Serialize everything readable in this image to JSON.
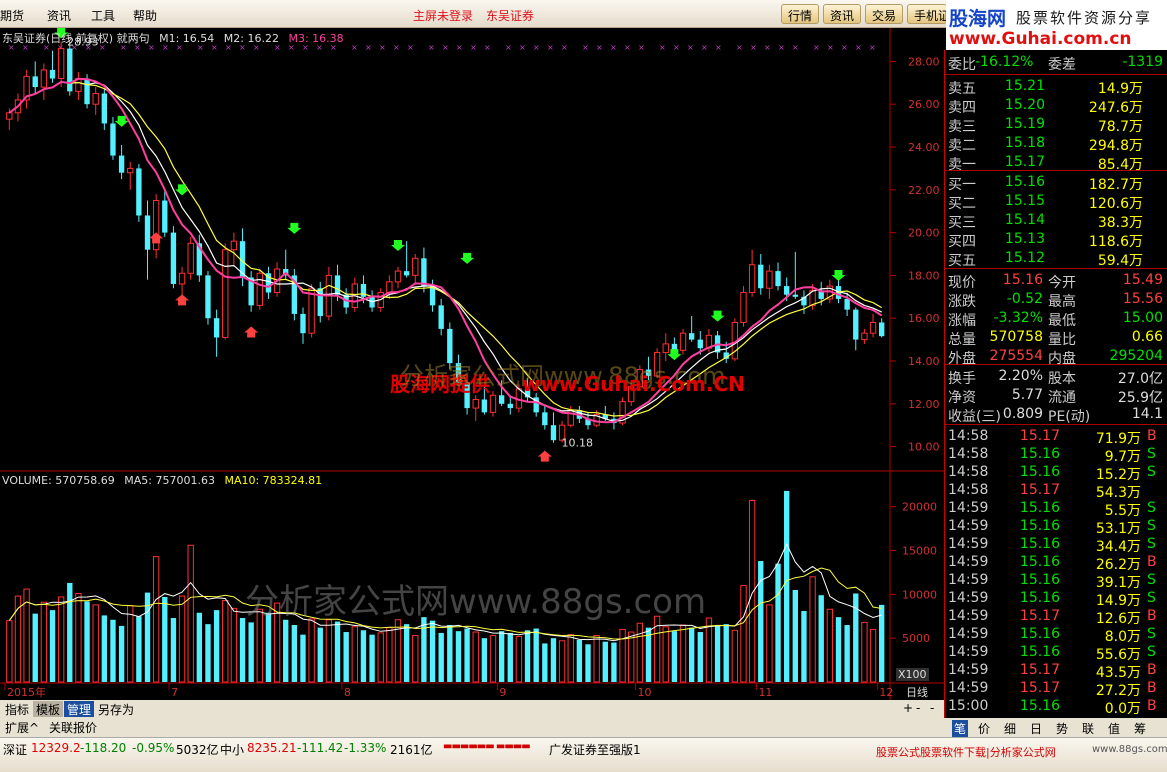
{
  "menu": {
    "items": [
      "期货",
      "资讯",
      "工具",
      "帮助"
    ],
    "notice": [
      "主屏未登录",
      "东吴证券"
    ],
    "buttons": [
      "行情",
      "资讯",
      "交易",
      "手机证"
    ]
  },
  "logo": {
    "name": "股海网",
    "tagline": "股票软件资源分享",
    "url": "www.Guhai.com.cn"
  },
  "chart": {
    "header": {
      "title": "东吴证券(日线 前复权) 就两句",
      "m1": "M1: 16.54",
      "m2": "M2: 16.22",
      "m3": "M3: 16.38"
    },
    "high_label": "28.93",
    "low_label": "10.18",
    "volume_header": {
      "label": "VOLUME: 570758.69",
      "ma5": "MA5: 757001.63",
      "ma10": "MA10: 783324.81"
    },
    "x100": "X100",
    "period": "日线",
    "watermark1": "分析家公式网www.88gs.com",
    "watermark2": "股海网提供",
    "watermark3": "www.Guhai.Com.CN",
    "watermark4": "分析家公式网www.88gs.com"
  },
  "chart_data": {
    "type": "candlestick",
    "ylim": [
      9,
      29
    ],
    "yticks": [
      "28.00",
      "26.00",
      "24.00",
      "22.00",
      "20.00",
      "18.00",
      "16.00",
      "14.00",
      "12.00",
      "10.00"
    ],
    "vticks": [
      "20000",
      "15000",
      "10000",
      "5000"
    ],
    "months": [
      "2015年",
      "7",
      "8",
      "9",
      "10",
      "11",
      "12"
    ],
    "candles": [
      [
        25.3,
        25.8,
        24.8,
        25.6
      ],
      [
        25.6,
        26.5,
        25.2,
        26.2
      ],
      [
        26.2,
        27.6,
        25.8,
        27.3
      ],
      [
        27.3,
        28.0,
        26.5,
        26.8
      ],
      [
        26.8,
        27.9,
        26.2,
        27.6
      ],
      [
        27.6,
        28.5,
        27.0,
        27.2
      ],
      [
        27.2,
        28.93,
        26.8,
        28.6
      ],
      [
        28.6,
        28.8,
        26.4,
        26.6
      ],
      [
        26.6,
        27.5,
        26.2,
        27.2
      ],
      [
        27.2,
        27.4,
        25.8,
        26.0
      ],
      [
        26.0,
        26.8,
        25.5,
        26.5
      ],
      [
        26.5,
        26.7,
        24.8,
        25.1
      ],
      [
        25.1,
        25.4,
        23.4,
        23.6
      ],
      [
        23.6,
        24.1,
        22.5,
        22.8
      ],
      [
        22.8,
        23.3,
        22.0,
        23.0
      ],
      [
        23.0,
        23.2,
        20.5,
        20.8
      ],
      [
        20.8,
        21.5,
        17.8,
        19.2
      ],
      [
        19.2,
        21.8,
        18.8,
        21.5
      ],
      [
        21.5,
        22.0,
        19.8,
        20.0
      ],
      [
        20.0,
        20.3,
        17.4,
        17.6
      ],
      [
        17.6,
        18.4,
        16.8,
        18.1
      ],
      [
        18.1,
        19.8,
        17.8,
        19.5
      ],
      [
        19.5,
        19.9,
        17.7,
        18.0
      ],
      [
        18.0,
        18.2,
        15.7,
        16.0
      ],
      [
        16.0,
        16.4,
        14.2,
        15.1
      ],
      [
        15.1,
        19.5,
        15.0,
        19.2
      ],
      [
        19.2,
        20.0,
        18.5,
        19.6
      ],
      [
        19.6,
        20.2,
        17.5,
        17.9
      ],
      [
        17.9,
        18.2,
        16.3,
        16.6
      ],
      [
        16.6,
        18.3,
        16.4,
        18.1
      ],
      [
        18.1,
        18.4,
        16.9,
        17.2
      ],
      [
        17.2,
        18.6,
        17.0,
        18.3
      ],
      [
        18.3,
        19.2,
        17.8,
        18.0
      ],
      [
        18.0,
        18.3,
        15.9,
        16.2
      ],
      [
        16.2,
        16.5,
        14.8,
        15.3
      ],
      [
        15.3,
        17.6,
        15.1,
        17.4
      ],
      [
        17.4,
        17.7,
        15.8,
        16.1
      ],
      [
        16.1,
        18.4,
        15.9,
        18.0
      ],
      [
        18.0,
        18.5,
        16.8,
        17.1
      ],
      [
        17.1,
        17.4,
        16.2,
        16.5
      ],
      [
        16.5,
        17.9,
        16.3,
        17.6
      ],
      [
        17.6,
        18.0,
        16.7,
        17.0
      ],
      [
        17.0,
        17.3,
        16.3,
        16.5
      ],
      [
        16.5,
        17.4,
        16.3,
        17.2
      ],
      [
        17.2,
        18.0,
        16.9,
        17.7
      ],
      [
        17.7,
        18.4,
        17.4,
        18.2
      ],
      [
        18.2,
        19.6,
        17.9,
        18.0
      ],
      [
        18.0,
        19.0,
        17.6,
        18.8
      ],
      [
        18.8,
        19.3,
        17.2,
        17.5
      ],
      [
        17.5,
        17.8,
        16.3,
        16.6
      ],
      [
        16.6,
        16.9,
        15.2,
        15.5
      ],
      [
        15.5,
        15.8,
        13.6,
        13.9
      ],
      [
        13.9,
        14.3,
        12.7,
        13.0
      ],
      [
        13.0,
        13.2,
        11.5,
        11.8
      ],
      [
        11.8,
        12.4,
        11.2,
        12.2
      ],
      [
        12.2,
        12.9,
        11.5,
        11.6
      ],
      [
        11.6,
        12.6,
        11.4,
        12.4
      ],
      [
        12.4,
        13.1,
        11.9,
        12.0
      ],
      [
        12.0,
        12.4,
        11.5,
        11.8
      ],
      [
        11.8,
        12.9,
        11.6,
        12.7
      ],
      [
        12.7,
        13.2,
        12.1,
        12.3
      ],
      [
        12.3,
        12.5,
        11.4,
        11.6
      ],
      [
        11.6,
        11.9,
        10.8,
        11.0
      ],
      [
        11.0,
        11.6,
        10.18,
        10.3
      ],
      [
        10.3,
        11.2,
        10.2,
        11.0
      ],
      [
        11.0,
        11.9,
        10.9,
        11.7
      ],
      [
        11.7,
        11.9,
        11.1,
        11.3
      ],
      [
        11.3,
        11.6,
        10.8,
        11.0
      ],
      [
        11.0,
        11.7,
        10.9,
        11.5
      ],
      [
        11.5,
        11.9,
        11.2,
        11.3
      ],
      [
        11.3,
        11.6,
        10.8,
        11.1
      ],
      [
        11.1,
        12.3,
        11.0,
        12.1
      ],
      [
        12.1,
        13.0,
        11.9,
        12.8
      ],
      [
        12.8,
        13.8,
        12.6,
        13.6
      ],
      [
        13.6,
        14.2,
        13.1,
        13.3
      ],
      [
        13.3,
        14.6,
        13.2,
        14.4
      ],
      [
        14.4,
        15.3,
        14.0,
        14.8
      ],
      [
        14.8,
        15.1,
        14.2,
        14.5
      ],
      [
        14.5,
        15.5,
        14.3,
        15.3
      ],
      [
        15.3,
        16.1,
        14.9,
        15.0
      ],
      [
        15.0,
        15.4,
        14.3,
        14.6
      ],
      [
        14.6,
        15.5,
        14.4,
        15.2
      ],
      [
        15.2,
        15.4,
        14.1,
        14.4
      ],
      [
        14.4,
        14.9,
        13.9,
        14.1
      ],
      [
        14.1,
        16.0,
        14.0,
        15.8
      ],
      [
        15.8,
        17.5,
        15.6,
        17.2
      ],
      [
        17.2,
        19.2,
        17.0,
        18.5
      ],
      [
        18.5,
        19.0,
        17.1,
        17.4
      ],
      [
        17.4,
        18.5,
        16.9,
        18.2
      ],
      [
        18.2,
        18.6,
        17.3,
        17.5
      ],
      [
        17.5,
        17.9,
        16.8,
        17.1
      ],
      [
        17.1,
        19.1,
        16.9,
        17.0
      ],
      [
        17.0,
        17.3,
        16.2,
        16.6
      ],
      [
        16.6,
        17.6,
        16.4,
        17.3
      ],
      [
        17.3,
        17.7,
        16.6,
        16.9
      ],
      [
        16.9,
        17.8,
        16.7,
        17.5
      ],
      [
        17.5,
        17.8,
        16.7,
        16.9
      ],
      [
        16.9,
        17.2,
        16.1,
        16.4
      ],
      [
        16.4,
        16.5,
        14.5,
        15.0
      ],
      [
        15.0,
        15.5,
        14.8,
        15.3
      ],
      [
        15.3,
        16.2,
        15.1,
        15.8
      ],
      [
        15.8,
        16.0,
        15.1,
        15.16
      ]
    ],
    "volumes": [
      7000,
      9800,
      10600,
      7800,
      9100,
      8200,
      9700,
      11300,
      10100,
      9200,
      8800,
      7600,
      7100,
      6400,
      8700,
      7500,
      10200,
      14300,
      9700,
      7300,
      9800,
      15600,
      7900,
      6600,
      8200,
      9300,
      8400,
      7300,
      6800,
      8300,
      7900,
      9000,
      7100,
      6500,
      5400,
      7200,
      6200,
      7100,
      6900,
      5700,
      6300,
      5900,
      5400,
      5600,
      6200,
      7100,
      6600,
      5300,
      7400,
      7000,
      5600,
      6500,
      5800,
      6100,
      5700,
      5000,
      5300,
      5800,
      5600,
      5200,
      5900,
      6100,
      4400,
      5000,
      4700,
      5400,
      4800,
      4300,
      5300,
      4600,
      4500,
      6000,
      5700,
      6700,
      6200,
      7500,
      6300,
      5800,
      6500,
      6200,
      5700,
      7300,
      6400,
      6600,
      5900,
      11000,
      20700,
      13800,
      8800,
      13500,
      21800,
      10500,
      8100,
      12000,
      9900,
      8300,
      7400,
      6500,
      10100,
      6800,
      6000,
      8800
    ],
    "ma_main": [
      26.9,
      26.6,
      26.0,
      25.3,
      24.6,
      23.9,
      23.1,
      22.3,
      21.6,
      20.8,
      20.1,
      19.6,
      19.2,
      18.9,
      18.6,
      18.4,
      18.2,
      17.9,
      17.7,
      17.7,
      17.5,
      17.4,
      17.4,
      17.3,
      17.2,
      17.2,
      17.1,
      17.0,
      16.9,
      16.5,
      15.9,
      15.2,
      14.5,
      13.8,
      13.2,
      12.7,
      12.4,
      12.2,
      12.0,
      11.9,
      11.7,
      11.5,
      11.4,
      11.3,
      11.3,
      11.4,
      11.5,
      11.8,
      12.1,
      12.6,
      13.1,
      13.5,
      14.0,
      14.3,
      14.5,
      14.8,
      15.2,
      15.7,
      16.2,
      16.6,
      16.8,
      17.0,
      17.1,
      17.2,
      17.2,
      17.0,
      16.6,
      16.2
    ],
    "ma_x": [
      8,
      25,
      45,
      60,
      75,
      90,
      105,
      120,
      135,
      150,
      165,
      180,
      195,
      210,
      225,
      240,
      255,
      270,
      285,
      300,
      315,
      330,
      345,
      360,
      375,
      390,
      405,
      420,
      435,
      450,
      465,
      480,
      495,
      510,
      525,
      540,
      555,
      570,
      585,
      600,
      615,
      630,
      645,
      660,
      675,
      690,
      705,
      720,
      735,
      750,
      765,
      780,
      795,
      810,
      825,
      840,
      855,
      870,
      885,
      900,
      915,
      930,
      945,
      960,
      975,
      990,
      1005,
      1020
    ]
  },
  "quote": {
    "top": {
      "l1": "委比",
      "v1": "-16.12%",
      "l2": "委差",
      "v2": "-1319"
    },
    "asks": [
      {
        "l": "卖五",
        "p": "15.21",
        "v": "14.9万"
      },
      {
        "l": "卖四",
        "p": "15.20",
        "v": "247.6万"
      },
      {
        "l": "卖三",
        "p": "15.19",
        "v": "78.7万"
      },
      {
        "l": "卖二",
        "p": "15.18",
        "v": "294.8万"
      },
      {
        "l": "卖一",
        "p": "15.17",
        "v": "85.4万"
      }
    ],
    "bids": [
      {
        "l": "买一",
        "p": "15.16",
        "v": "182.7万"
      },
      {
        "l": "买二",
        "p": "15.15",
        "v": "120.6万"
      },
      {
        "l": "买三",
        "p": "15.14",
        "v": "38.3万"
      },
      {
        "l": "买四",
        "p": "15.13",
        "v": "118.6万"
      },
      {
        "l": "买五",
        "p": "15.12",
        "v": "59.4万"
      }
    ],
    "stats": [
      {
        "l1": "现价",
        "v1": "15.16",
        "c1": "#ff4040",
        "l2": "今开",
        "v2": "15.49",
        "c2": "#ff4040"
      },
      {
        "l1": "涨跌",
        "v1": "-0.52",
        "c1": "#00e000",
        "l2": "最高",
        "v2": "15.56",
        "c2": "#ff4040"
      },
      {
        "l1": "涨幅",
        "v1": "-3.32%",
        "c1": "#00e000",
        "l2": "最低",
        "v2": "15.00",
        "c2": "#00e000"
      },
      {
        "l1": "总量",
        "v1": "570758",
        "c1": "#ffff00",
        "l2": "量比",
        "v2": "0.66",
        "c2": "#ffff00"
      },
      {
        "l1": "外盘",
        "v1": "275554",
        "c1": "#ff4040",
        "l2": "内盘",
        "v2": "295204",
        "c2": "#00e000"
      }
    ],
    "fund": [
      {
        "l1": "换手",
        "v1": "2.20%",
        "l2": "股本",
        "v2": "27.0亿"
      },
      {
        "l1": "净资",
        "v1": "5.77",
        "l2": "流通",
        "v2": "25.9亿"
      },
      {
        "l1": "收益(三)",
        "v1": "0.809",
        "l2": "PE(动)",
        "v2": "14.1"
      }
    ],
    "ticks": [
      {
        "t": "14:58",
        "p": "15.17",
        "v": "71.9万",
        "s": "B"
      },
      {
        "t": "14:58",
        "p": "15.16",
        "v": "9.7万",
        "s": "S"
      },
      {
        "t": "14:58",
        "p": "15.16",
        "v": "15.2万",
        "s": "S"
      },
      {
        "t": "14:58",
        "p": "15.17",
        "v": "54.3万",
        "s": ""
      },
      {
        "t": "14:59",
        "p": "15.16",
        "v": "5.5万",
        "s": "S"
      },
      {
        "t": "14:59",
        "p": "15.16",
        "v": "53.1万",
        "s": "S"
      },
      {
        "t": "14:59",
        "p": "15.16",
        "v": "34.4万",
        "s": "S"
      },
      {
        "t": "14:59",
        "p": "15.16",
        "v": "26.2万",
        "s": "B"
      },
      {
        "t": "14:59",
        "p": "15.16",
        "v": "39.1万",
        "s": "S"
      },
      {
        "t": "14:59",
        "p": "15.16",
        "v": "14.9万",
        "s": "S"
      },
      {
        "t": "14:59",
        "p": "15.17",
        "v": "12.6万",
        "s": "B"
      },
      {
        "t": "14:59",
        "p": "15.16",
        "v": "8.0万",
        "s": "S"
      },
      {
        "t": "14:59",
        "p": "15.16",
        "v": "55.6万",
        "s": "S"
      },
      {
        "t": "14:59",
        "p": "15.17",
        "v": "43.5万",
        "s": "B"
      },
      {
        "t": "14:59",
        "p": "15.17",
        "v": "27.2万",
        "s": "B"
      },
      {
        "t": "15:00",
        "p": "15.16",
        "v": "0.0万",
        "s": "B"
      }
    ]
  },
  "qtabs": [
    "笔",
    "价",
    "细",
    "日",
    "势",
    "联",
    "值",
    "筹"
  ],
  "tabs": {
    "row1": [
      "指标",
      "模板",
      "管理",
      "另存为"
    ],
    "row2": [
      "扩展^",
      "关联报价"
    ],
    "pm": [
      "+",
      "-",
      "-"
    ]
  },
  "status": {
    "sz_label": "深证",
    "sz_val": "12329.2",
    "sz_chg": "-118.20",
    "sz_pct": "-0.95%",
    "sz_amt": "5032亿",
    "zx_label": "中小",
    "zx_val": "8235.21",
    "zx_chg": "-111.42",
    "zx_pct": "-1.33%",
    "zx_amt": "2161亿",
    "ticker": "广发证券至强版1",
    "ad": "股票公式股票软件下载|分析家公式网",
    "ad_url": "www.88gs.com"
  }
}
